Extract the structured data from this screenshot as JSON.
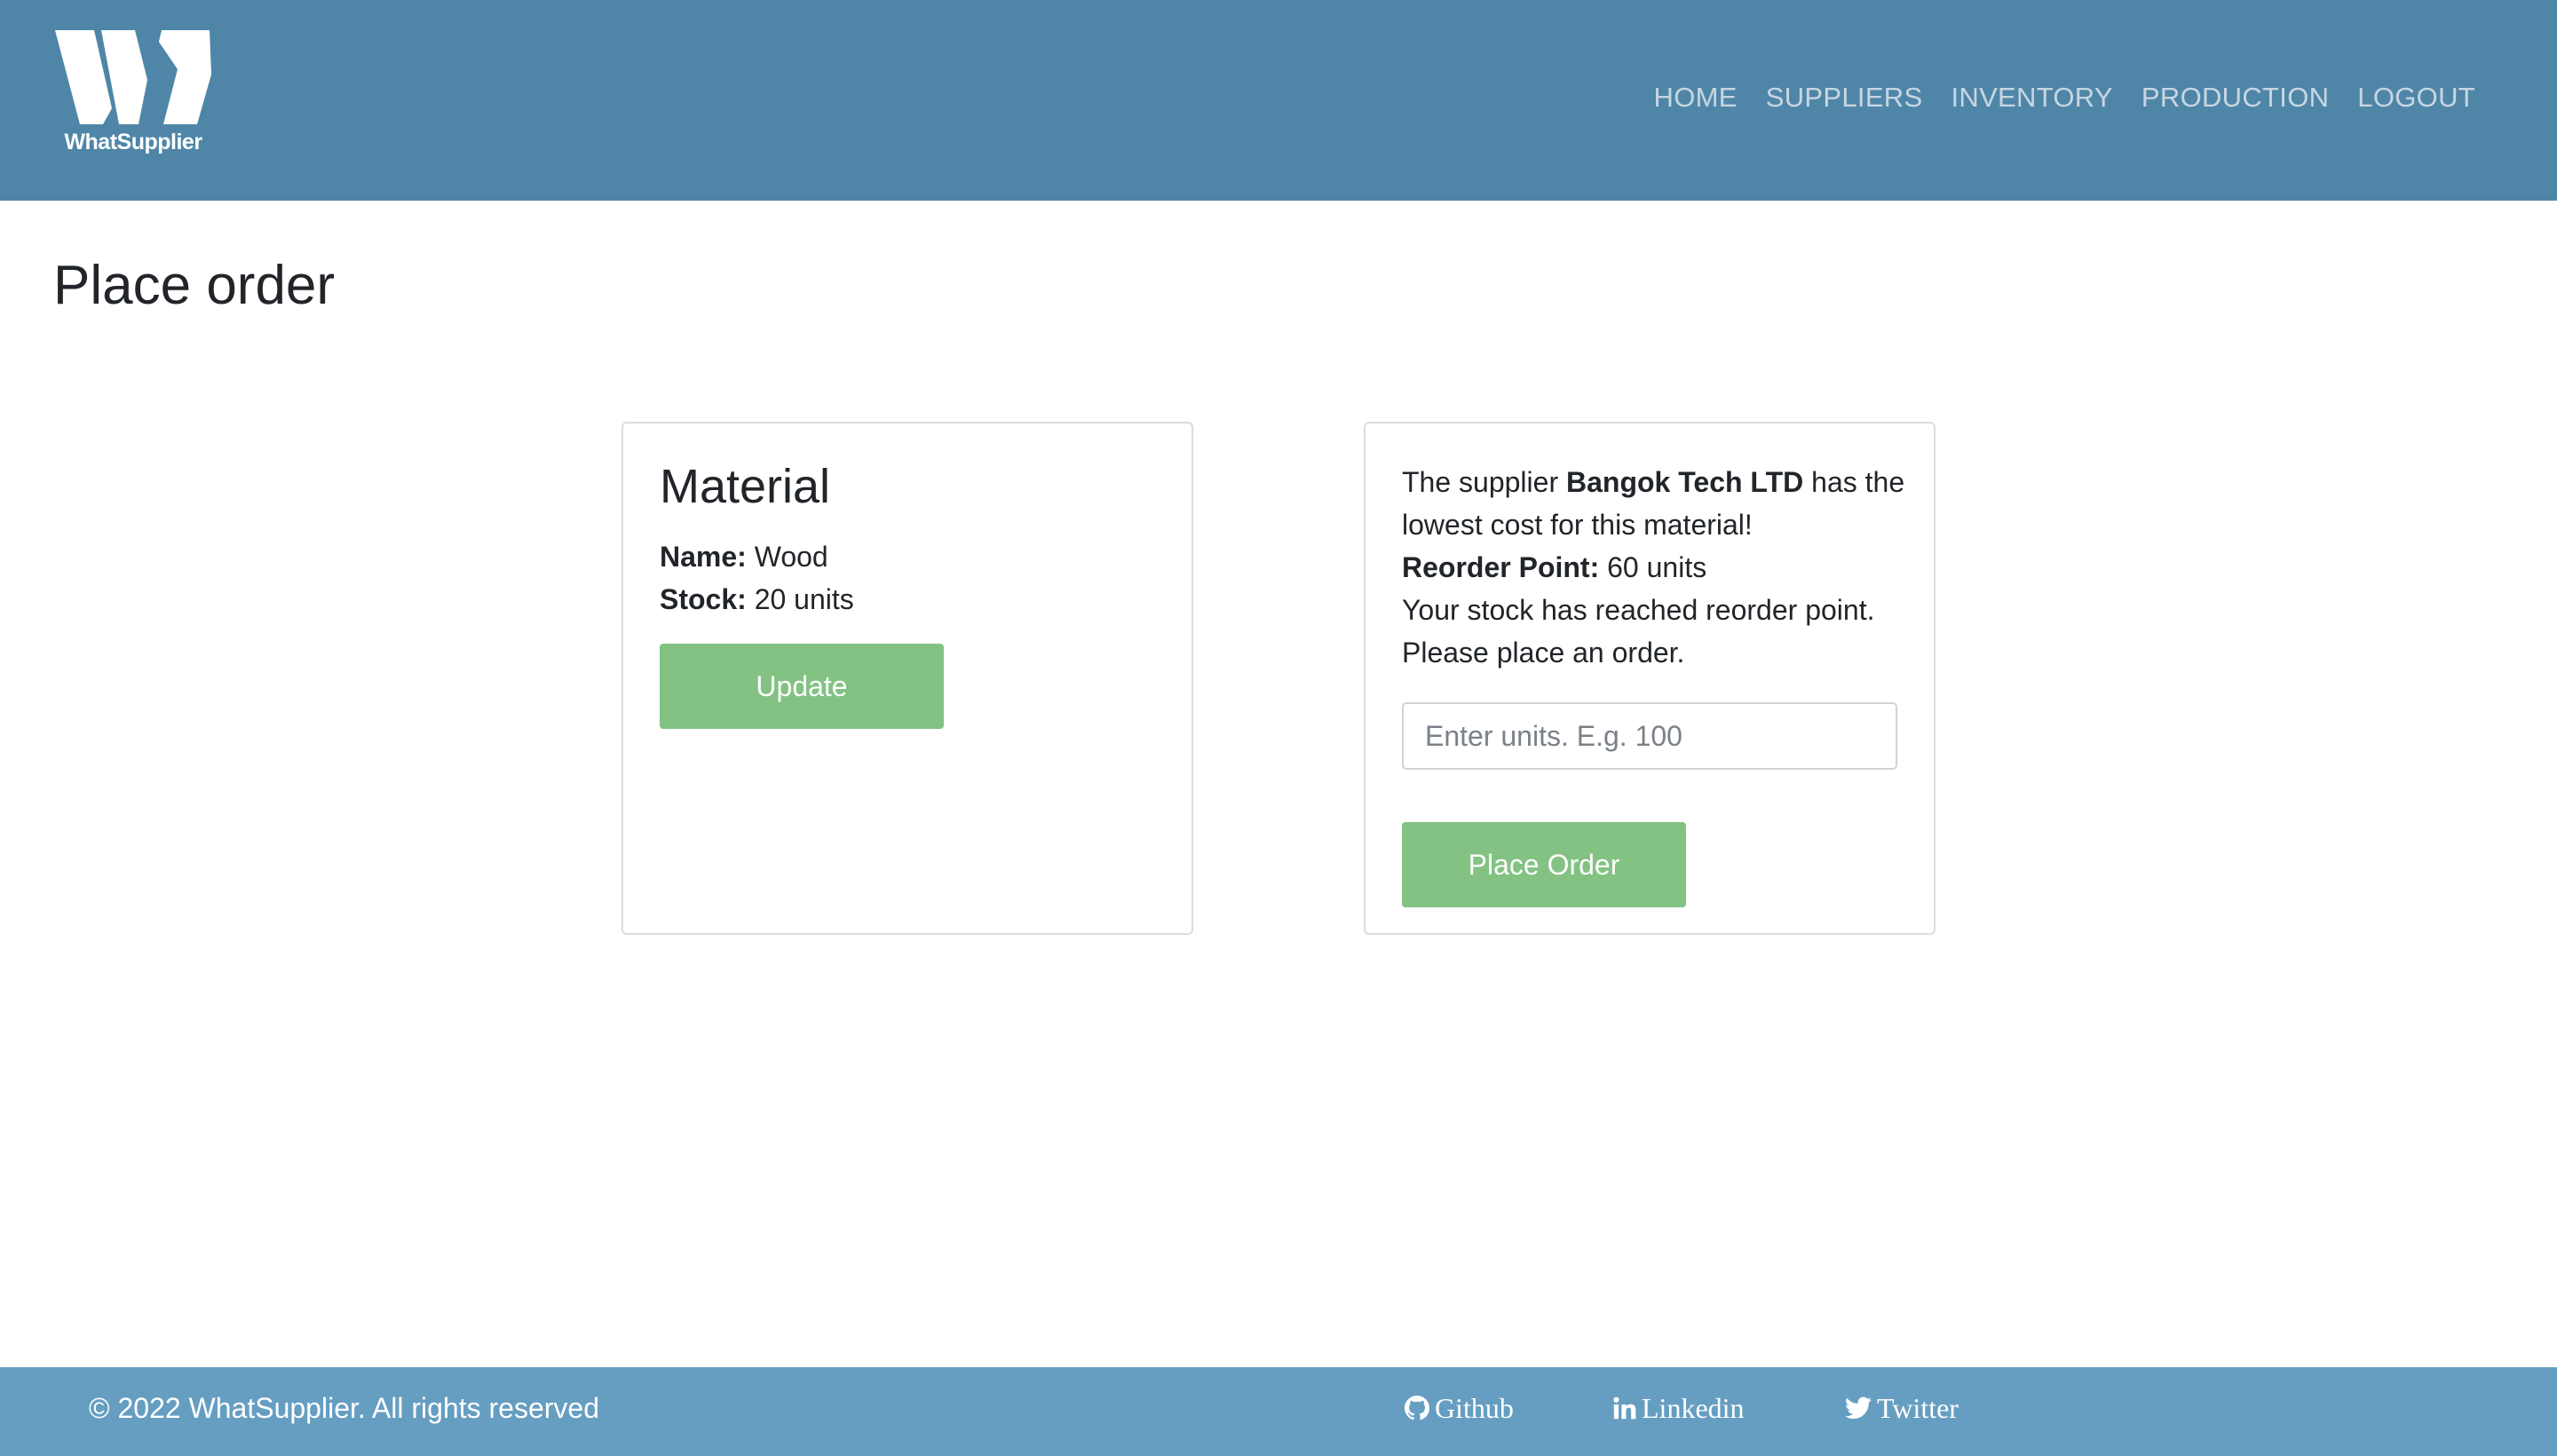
{
  "brand": {
    "name": "WhatSupplier"
  },
  "nav": {
    "items": [
      {
        "label": "HOME"
      },
      {
        "label": "SUPPLIERS"
      },
      {
        "label": "INVENTORY"
      },
      {
        "label": "PRODUCTION"
      },
      {
        "label": "LOGOUT"
      }
    ]
  },
  "page": {
    "title": "Place order"
  },
  "material": {
    "heading": "Material",
    "name_label": "Name:",
    "name_value": "Wood",
    "stock_label": "Stock:",
    "stock_value": "20 units",
    "update_button": "Update"
  },
  "order": {
    "supplier_prefix": "The supplier",
    "supplier_name": "Bangok Tech LTD",
    "supplier_suffix": "has the lowest cost for this material!",
    "reorder_label": "Reorder Point:",
    "reorder_value": "60 units",
    "warning": "Your stock has reached reorder point. Please place an order.",
    "units_placeholder": "Enter units. E.g. 100",
    "units_value": "",
    "place_button": "Place Order"
  },
  "footer": {
    "copyright": "© 2022 WhatSupplier. All rights reserved",
    "links": [
      {
        "label": "Github",
        "icon": "github-icon"
      },
      {
        "label": "Linkedin",
        "icon": "linkedin-icon"
      },
      {
        "label": "Twitter",
        "icon": "twitter-icon"
      }
    ]
  },
  "colors": {
    "header_bg": "#4f86a8",
    "footer_bg": "#669ec2",
    "button_bg": "#83c283",
    "nav_text": "#c7d6e2"
  }
}
